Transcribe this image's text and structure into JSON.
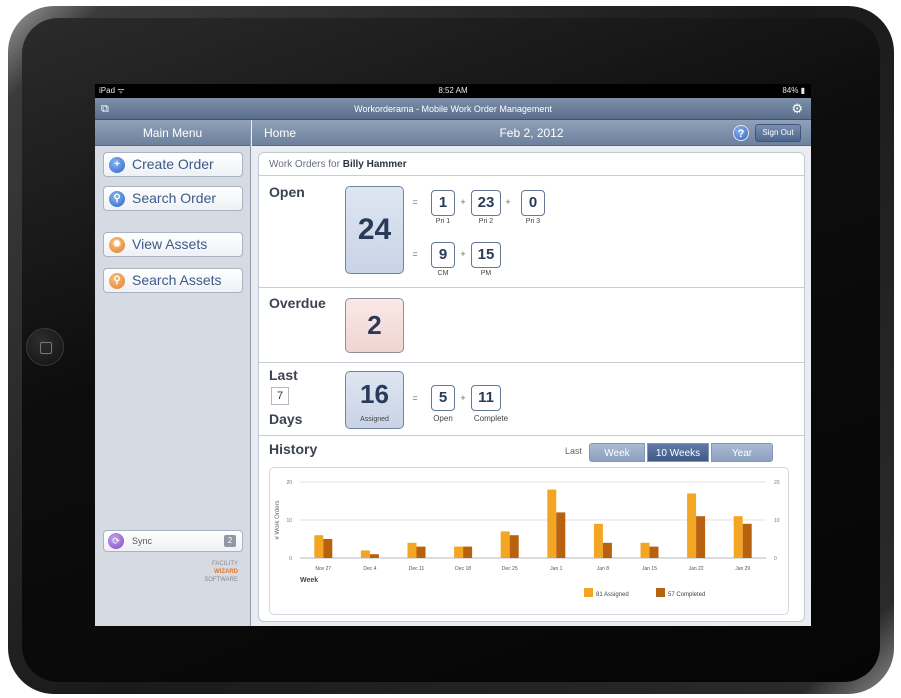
{
  "status_bar": {
    "carrier": "iPad",
    "time": "8:52 AM",
    "battery": "84%"
  },
  "app": {
    "title": "Workorderama - Mobile Work Order Management"
  },
  "sidebar": {
    "header": "Main Menu",
    "items": [
      {
        "label": "Create Order",
        "icon": "plus-icon"
      },
      {
        "label": "Search Order",
        "icon": "search-icon"
      },
      {
        "label": "View Assets",
        "icon": "asset-icon"
      },
      {
        "label": "Search Assets",
        "icon": "search-icon"
      }
    ],
    "sync": {
      "label": "Sync",
      "count": "2"
    },
    "brand": {
      "line1": "FACILITY",
      "line2": "WIZARD",
      "line3": "SOFTWARE"
    }
  },
  "header": {
    "home": "Home",
    "date": "Feb 2, 2012",
    "help": "?",
    "signout": "Sign Out"
  },
  "work_orders": {
    "for_label": "Work Orders for",
    "user": "Billy Hammer",
    "open": {
      "label": "Open",
      "total": "24",
      "priority": [
        {
          "value": "1",
          "label": "Pri 1"
        },
        {
          "value": "23",
          "label": "Pri 2"
        },
        {
          "value": "0",
          "label": "Pri 3"
        }
      ],
      "type": [
        {
          "value": "9",
          "label": "CM"
        },
        {
          "value": "15",
          "label": "PM"
        }
      ]
    },
    "overdue": {
      "label": "Overdue",
      "total": "2"
    },
    "last_days": {
      "label_top": "Last",
      "days": "7",
      "label_bottom": "Days",
      "total": "16",
      "total_label": "Assigned",
      "open": {
        "value": "5",
        "label": "Open"
      },
      "complete": {
        "value": "11",
        "label": "Complete"
      }
    },
    "ops": {
      "eq": "=",
      "plus": "+"
    }
  },
  "history": {
    "title": "History",
    "range_label": "Last",
    "ranges": [
      {
        "label": "Week",
        "active": false
      },
      {
        "label": "10 Weeks",
        "active": true
      },
      {
        "label": "Year",
        "active": false
      }
    ]
  },
  "chart_data": {
    "type": "bar",
    "categories": [
      "Nov 27",
      "Dec 4",
      "Dec 11",
      "Dec 18",
      "Dec 25",
      "Jan 1",
      "Jan 8",
      "Jan 15",
      "Jan 22",
      "Jan 29"
    ],
    "series": [
      {
        "name": "Assigned",
        "total": "81",
        "color": "#f3a623",
        "values": [
          6,
          2,
          4,
          3,
          7,
          18,
          9,
          4,
          17,
          11
        ]
      },
      {
        "name": "Completed",
        "total": "57",
        "color": "#b8610f",
        "values": [
          5,
          1,
          3,
          3,
          6,
          12,
          4,
          3,
          11,
          9
        ]
      }
    ],
    "ylabel": "# Work Orders",
    "xlabel": "Week",
    "ylim": [
      0,
      20
    ],
    "yticks": [
      0,
      10,
      20
    ],
    "grid": true,
    "legend_placement": "bottom-right"
  }
}
